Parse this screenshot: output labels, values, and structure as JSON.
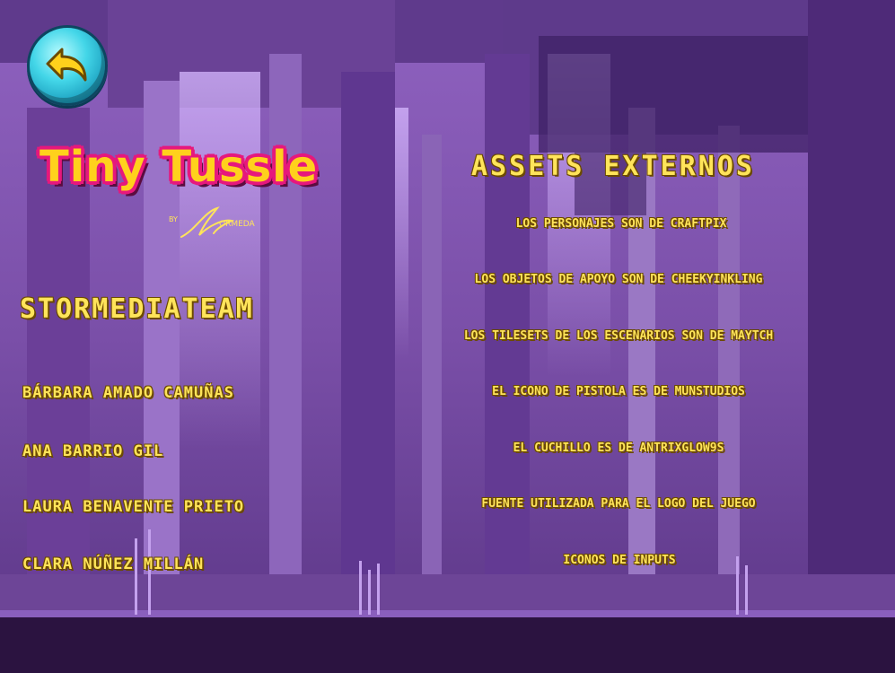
{
  "back_button": {
    "icon": "back-arrow-icon"
  },
  "logo": {
    "title": "Tiny Tussle",
    "by": "BY",
    "signature": "Stormeda",
    "title_color": "#ffd11c",
    "outline_color": "#e6187d"
  },
  "team": {
    "title": "STORMEDIATEAM",
    "members": [
      "BÁRBARA AMADO CAMUÑAS",
      "ANA BARRIO GIL",
      "LAURA BENAVENTE PRIETO",
      "CLARA NÚÑEZ MILLÁN"
    ]
  },
  "assets": {
    "title": "ASSETS EXTERNOS",
    "lines": [
      "LOS PERSONAJES SON DE CRAFTPIX",
      "LOS OBJETOS DE APOYO SON DE CHEEKYINKLING",
      "LOS TILESETS DE LOS ESCENARIOS SON DE MAYTCH",
      "EL ICONO DE PISTOLA ES DE MUNSTUDIOS",
      "EL CUCHILLO ES DE ANTRIXGLOW9S",
      "FUENTE UTILIZADA PARA EL LOGO DEL JUEGO",
      "ICONOS DE INPUTS"
    ]
  },
  "colors": {
    "text": "#ffe45a",
    "sky": "#7a4fa8",
    "forest_dark": "#3a1b52",
    "ground": "#2b1340"
  }
}
